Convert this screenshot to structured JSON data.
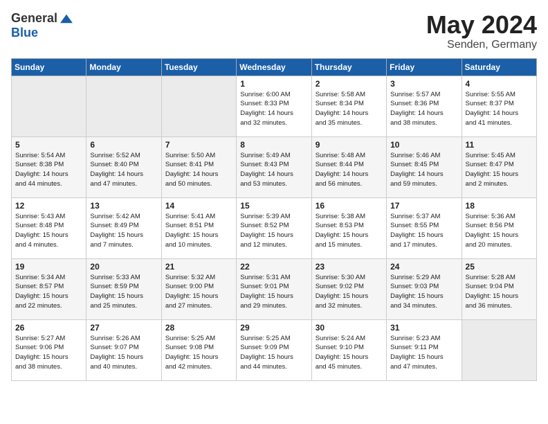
{
  "header": {
    "logo_general": "General",
    "logo_blue": "Blue",
    "month": "May 2024",
    "location": "Senden, Germany"
  },
  "days_of_week": [
    "Sunday",
    "Monday",
    "Tuesday",
    "Wednesday",
    "Thursday",
    "Friday",
    "Saturday"
  ],
  "weeks": [
    [
      {
        "num": "",
        "detail": ""
      },
      {
        "num": "",
        "detail": ""
      },
      {
        "num": "",
        "detail": ""
      },
      {
        "num": "1",
        "detail": "Sunrise: 6:00 AM\nSunset: 8:33 PM\nDaylight: 14 hours\nand 32 minutes."
      },
      {
        "num": "2",
        "detail": "Sunrise: 5:58 AM\nSunset: 8:34 PM\nDaylight: 14 hours\nand 35 minutes."
      },
      {
        "num": "3",
        "detail": "Sunrise: 5:57 AM\nSunset: 8:36 PM\nDaylight: 14 hours\nand 38 minutes."
      },
      {
        "num": "4",
        "detail": "Sunrise: 5:55 AM\nSunset: 8:37 PM\nDaylight: 14 hours\nand 41 minutes."
      }
    ],
    [
      {
        "num": "5",
        "detail": "Sunrise: 5:54 AM\nSunset: 8:38 PM\nDaylight: 14 hours\nand 44 minutes."
      },
      {
        "num": "6",
        "detail": "Sunrise: 5:52 AM\nSunset: 8:40 PM\nDaylight: 14 hours\nand 47 minutes."
      },
      {
        "num": "7",
        "detail": "Sunrise: 5:50 AM\nSunset: 8:41 PM\nDaylight: 14 hours\nand 50 minutes."
      },
      {
        "num": "8",
        "detail": "Sunrise: 5:49 AM\nSunset: 8:43 PM\nDaylight: 14 hours\nand 53 minutes."
      },
      {
        "num": "9",
        "detail": "Sunrise: 5:48 AM\nSunset: 8:44 PM\nDaylight: 14 hours\nand 56 minutes."
      },
      {
        "num": "10",
        "detail": "Sunrise: 5:46 AM\nSunset: 8:45 PM\nDaylight: 14 hours\nand 59 minutes."
      },
      {
        "num": "11",
        "detail": "Sunrise: 5:45 AM\nSunset: 8:47 PM\nDaylight: 15 hours\nand 2 minutes."
      }
    ],
    [
      {
        "num": "12",
        "detail": "Sunrise: 5:43 AM\nSunset: 8:48 PM\nDaylight: 15 hours\nand 4 minutes."
      },
      {
        "num": "13",
        "detail": "Sunrise: 5:42 AM\nSunset: 8:49 PM\nDaylight: 15 hours\nand 7 minutes."
      },
      {
        "num": "14",
        "detail": "Sunrise: 5:41 AM\nSunset: 8:51 PM\nDaylight: 15 hours\nand 10 minutes."
      },
      {
        "num": "15",
        "detail": "Sunrise: 5:39 AM\nSunset: 8:52 PM\nDaylight: 15 hours\nand 12 minutes."
      },
      {
        "num": "16",
        "detail": "Sunrise: 5:38 AM\nSunset: 8:53 PM\nDaylight: 15 hours\nand 15 minutes."
      },
      {
        "num": "17",
        "detail": "Sunrise: 5:37 AM\nSunset: 8:55 PM\nDaylight: 15 hours\nand 17 minutes."
      },
      {
        "num": "18",
        "detail": "Sunrise: 5:36 AM\nSunset: 8:56 PM\nDaylight: 15 hours\nand 20 minutes."
      }
    ],
    [
      {
        "num": "19",
        "detail": "Sunrise: 5:34 AM\nSunset: 8:57 PM\nDaylight: 15 hours\nand 22 minutes."
      },
      {
        "num": "20",
        "detail": "Sunrise: 5:33 AM\nSunset: 8:59 PM\nDaylight: 15 hours\nand 25 minutes."
      },
      {
        "num": "21",
        "detail": "Sunrise: 5:32 AM\nSunset: 9:00 PM\nDaylight: 15 hours\nand 27 minutes."
      },
      {
        "num": "22",
        "detail": "Sunrise: 5:31 AM\nSunset: 9:01 PM\nDaylight: 15 hours\nand 29 minutes."
      },
      {
        "num": "23",
        "detail": "Sunrise: 5:30 AM\nSunset: 9:02 PM\nDaylight: 15 hours\nand 32 minutes."
      },
      {
        "num": "24",
        "detail": "Sunrise: 5:29 AM\nSunset: 9:03 PM\nDaylight: 15 hours\nand 34 minutes."
      },
      {
        "num": "25",
        "detail": "Sunrise: 5:28 AM\nSunset: 9:04 PM\nDaylight: 15 hours\nand 36 minutes."
      }
    ],
    [
      {
        "num": "26",
        "detail": "Sunrise: 5:27 AM\nSunset: 9:06 PM\nDaylight: 15 hours\nand 38 minutes."
      },
      {
        "num": "27",
        "detail": "Sunrise: 5:26 AM\nSunset: 9:07 PM\nDaylight: 15 hours\nand 40 minutes."
      },
      {
        "num": "28",
        "detail": "Sunrise: 5:25 AM\nSunset: 9:08 PM\nDaylight: 15 hours\nand 42 minutes."
      },
      {
        "num": "29",
        "detail": "Sunrise: 5:25 AM\nSunset: 9:09 PM\nDaylight: 15 hours\nand 44 minutes."
      },
      {
        "num": "30",
        "detail": "Sunrise: 5:24 AM\nSunset: 9:10 PM\nDaylight: 15 hours\nand 45 minutes."
      },
      {
        "num": "31",
        "detail": "Sunrise: 5:23 AM\nSunset: 9:11 PM\nDaylight: 15 hours\nand 47 minutes."
      },
      {
        "num": "",
        "detail": ""
      }
    ]
  ]
}
